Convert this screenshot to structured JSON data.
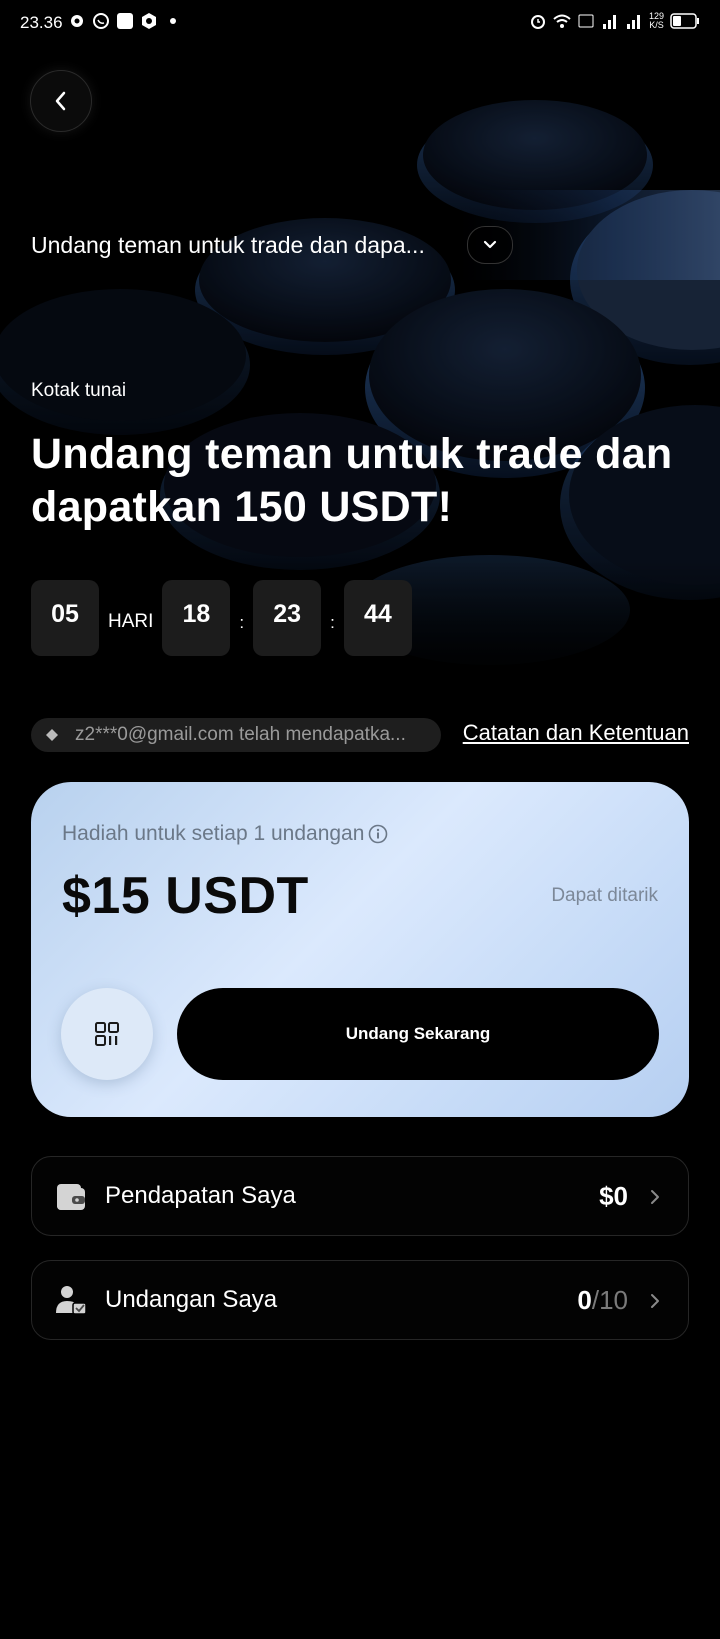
{
  "status_bar": {
    "time": "23.36",
    "battery_speed": "129",
    "speed_unit": "K/S"
  },
  "header": {
    "back_icon": "chevron-left-icon",
    "campaign_title": "Undang teman untuk trade dan dapa...",
    "campaign_dropdown_icon": "chevron-down-icon"
  },
  "hero": {
    "category": "Kotak tunai",
    "headline": "Undang teman untuk trade dan dapatkan 150 USDT!"
  },
  "countdown": {
    "days": "05",
    "days_label": "HARI",
    "hours": "18",
    "minutes": "23",
    "seconds": "44",
    "separator": ":"
  },
  "notice": {
    "icon": "diamond-icon",
    "text": "z2***0@gmail.com telah mendapatka...",
    "terms_link": "Catatan dan Ketentuan"
  },
  "reward_card": {
    "label": "Hadiah untuk setiap 1 undangan",
    "info_icon": "info-icon",
    "amount": "$15 USDT",
    "status": "Dapat ditarik",
    "qr_icon": "qr-code-icon",
    "invite_button": "Undang Sekarang"
  },
  "earnings": {
    "icon": "wallet-icon",
    "label": "Pendapatan Saya",
    "value": "$0"
  },
  "invitations": {
    "icon": "user-add-icon",
    "label": "Undangan Saya",
    "count": "0",
    "total": "/10"
  },
  "colors": {
    "background": "#000000",
    "card_gradient_start": "#b8d1ee",
    "card_gradient_end": "#b6cff1",
    "button_dark": "#000000"
  }
}
